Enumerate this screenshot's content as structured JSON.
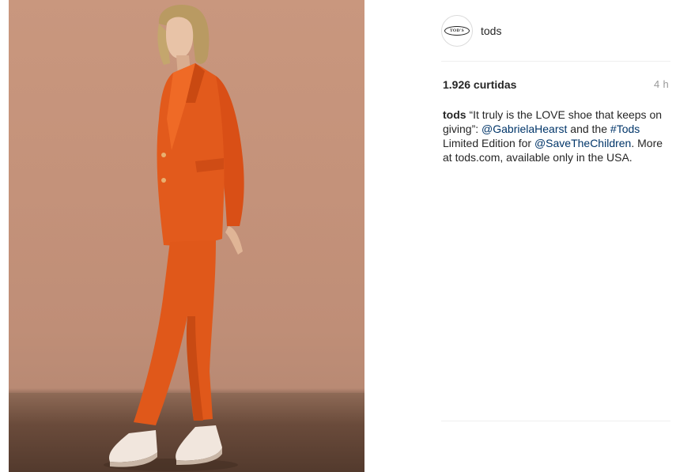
{
  "post": {
    "username": "tods",
    "avatar_logo_text": "TOD'S",
    "likes": "1.926 curtidas",
    "time": "4 h",
    "caption": {
      "owner": "tods",
      "text_1": " “It truly is the LOVE shoe that keeps on giving”: ",
      "mention_1": "@GabrielaHearst",
      "text_2": " and the ",
      "hashtag": "#Tods",
      "text_3": " Limited Edition for ",
      "mention_2": "@SaveTheChildren",
      "text_4": ". More at tods.com, available only in the USA."
    }
  },
  "colors": {
    "wall": "#c9977e",
    "floor": "#6a4b3b",
    "suit": "#e25a1c",
    "link": "#003569",
    "muted": "#999999",
    "text": "#262626"
  }
}
